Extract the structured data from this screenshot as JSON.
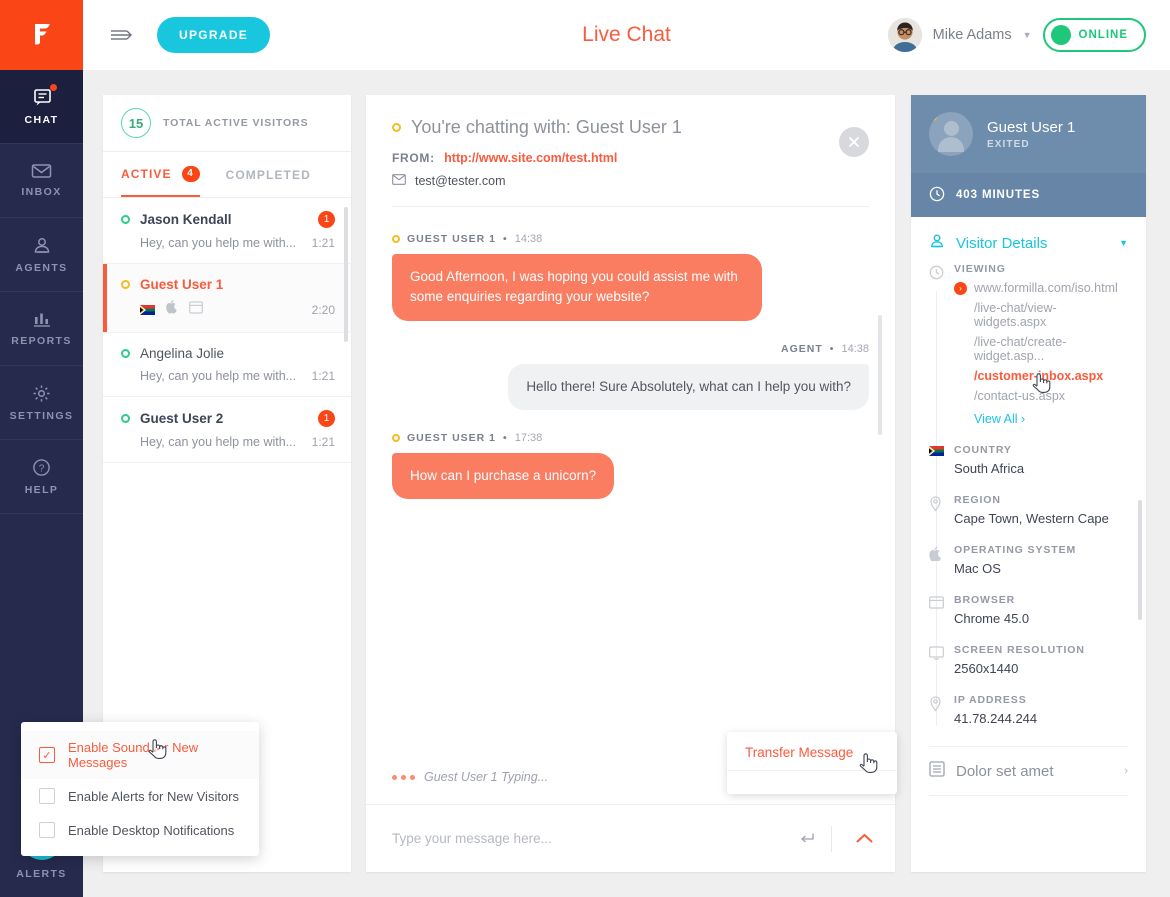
{
  "brand": {
    "logo_icon": "formilla-flag-logo",
    "accent_orange": "#fa5b3d",
    "accent_red": "#fa4616",
    "accent_cyan": "#18c6de",
    "accent_green": "#1ec77a",
    "navy": "#262a4d"
  },
  "topbar": {
    "menu_icon": "hamburger-arrow-icon",
    "upgrade_label": "UPGRADE",
    "title": "Live Chat",
    "user_name": "Mike Adams",
    "user_caret": "▼",
    "status_label": "ONLINE"
  },
  "nav": {
    "items": [
      {
        "label": "CHAT",
        "icon": "chat-bubble-icon",
        "active": true,
        "dot": true
      },
      {
        "label": "INBOX",
        "icon": "envelope-icon",
        "active": false,
        "dot": false
      },
      {
        "label": "AGENTS",
        "icon": "agents-icon",
        "active": false,
        "dot": false
      },
      {
        "label": "REPORTS",
        "icon": "bar-chart-icon",
        "active": false,
        "dot": false
      },
      {
        "label": "SETTINGS",
        "icon": "gear-icon",
        "active": false,
        "dot": false
      },
      {
        "label": "HELP",
        "icon": "question-circle-icon",
        "active": false,
        "dot": false
      }
    ],
    "alerts_label": "ALERTS",
    "alerts_icon": "bell-icon"
  },
  "visitor_list": {
    "total_count": "15",
    "total_label": "TOTAL ACTIVE VISITORS",
    "tabs": [
      {
        "label": "ACTIVE",
        "badge": "4",
        "active": true
      },
      {
        "label": "COMPLETED",
        "badge": "",
        "active": false
      }
    ],
    "rows": [
      {
        "name": "Jason Kendall",
        "status": "green",
        "badge": "1",
        "preview": "Hey, can you help me with...",
        "time": "1:21",
        "selected": false,
        "icons": []
      },
      {
        "name": "Guest User 1",
        "status": "amber",
        "badge": "",
        "preview": "",
        "time": "2:20",
        "selected": true,
        "icons": [
          "flag-south-africa-icon",
          "apple-icon",
          "browser-window-icon"
        ]
      },
      {
        "name": "Angelina Jolie",
        "status": "green",
        "badge": "",
        "preview": "Hey, can you help me with...",
        "time": "1:21",
        "selected": false,
        "icons": []
      },
      {
        "name": "Guest User 2",
        "status": "green",
        "badge": "1",
        "preview": "Hey, can you help me with...",
        "time": "1:21",
        "selected": false,
        "icons": []
      }
    ]
  },
  "chat": {
    "title": "You're chatting with: Guest User 1",
    "from_key": "FROM:",
    "from_value": "http://www.site.com/test.html",
    "email": "test@tester.com",
    "email_icon": "envelope-icon",
    "close_icon": "close-icon",
    "messages": [
      {
        "author": "GUEST USER 1",
        "time": "14:38",
        "side": "left",
        "text": "Good Afternoon, I was hoping you could assist me with some enquiries regarding your website?"
      },
      {
        "author": "AGENT",
        "time": "14:38",
        "side": "right",
        "text": "Hello there! Sure Absolutely, what can I help you with?"
      },
      {
        "author": "GUEST USER 1",
        "time": "17:38",
        "side": "left",
        "text": "How can I purchase a unicorn?"
      }
    ],
    "typing_text": "Guest User 1 Typing...",
    "composer_placeholder": "Type your message here...",
    "composer_value": "",
    "enter_icon": "enter-return-icon",
    "expand_icon": "chevron-up-icon"
  },
  "transfer_popup": {
    "label": "Transfer Message"
  },
  "details": {
    "name": "Guest User 1",
    "status": "EXITED",
    "duration": "403 MINUTES",
    "clock_icon": "clock-icon",
    "section_title": "Visitor Details",
    "section_icon": "visitor-icon",
    "section_caret": "▼",
    "viewing": {
      "key": "VIEWING",
      "icon": "history-clock-icon",
      "pages": [
        {
          "text": "www.formilla.com/iso.html",
          "current": false,
          "live": true
        },
        {
          "text": "/live-chat/view-widgets.aspx",
          "current": false,
          "live": false
        },
        {
          "text": "/live-chat/create-widget.asp...",
          "current": false,
          "live": false
        },
        {
          "text": "/customer-inbox.aspx",
          "current": true,
          "live": false
        },
        {
          "text": "/contact-us.aspx",
          "current": false,
          "live": false
        }
      ],
      "view_all": "View All  ›"
    },
    "fields": [
      {
        "key": "COUNTRY",
        "value": "South Africa",
        "icon": "flag-south-africa-icon"
      },
      {
        "key": "REGION",
        "value": "Cape Town, Western Cape",
        "icon": "map-pin-icon"
      },
      {
        "key": "OPERATING SYSTEM",
        "value": "Mac OS",
        "icon": "apple-icon"
      },
      {
        "key": "BROWSER",
        "value": "Chrome 45.0",
        "icon": "browser-window-icon"
      },
      {
        "key": "SCREEN RESOLUTION",
        "value": "2560x1440",
        "icon": "monitor-icon"
      },
      {
        "key": "IP ADDRESS",
        "value": "41.78.244.244",
        "icon": "map-pin-icon"
      }
    ],
    "footer_label": "Dolor set amet",
    "footer_icon": "list-document-icon",
    "footer_arrow": "›"
  },
  "notifications_popup": {
    "items": [
      {
        "label": "Enable Sound for New Messages",
        "checked": true
      },
      {
        "label": "Enable Alerts for New Visitors",
        "checked": false
      },
      {
        "label": "Enable Desktop Notifications",
        "checked": false
      }
    ],
    "check_glyph": "✓"
  }
}
